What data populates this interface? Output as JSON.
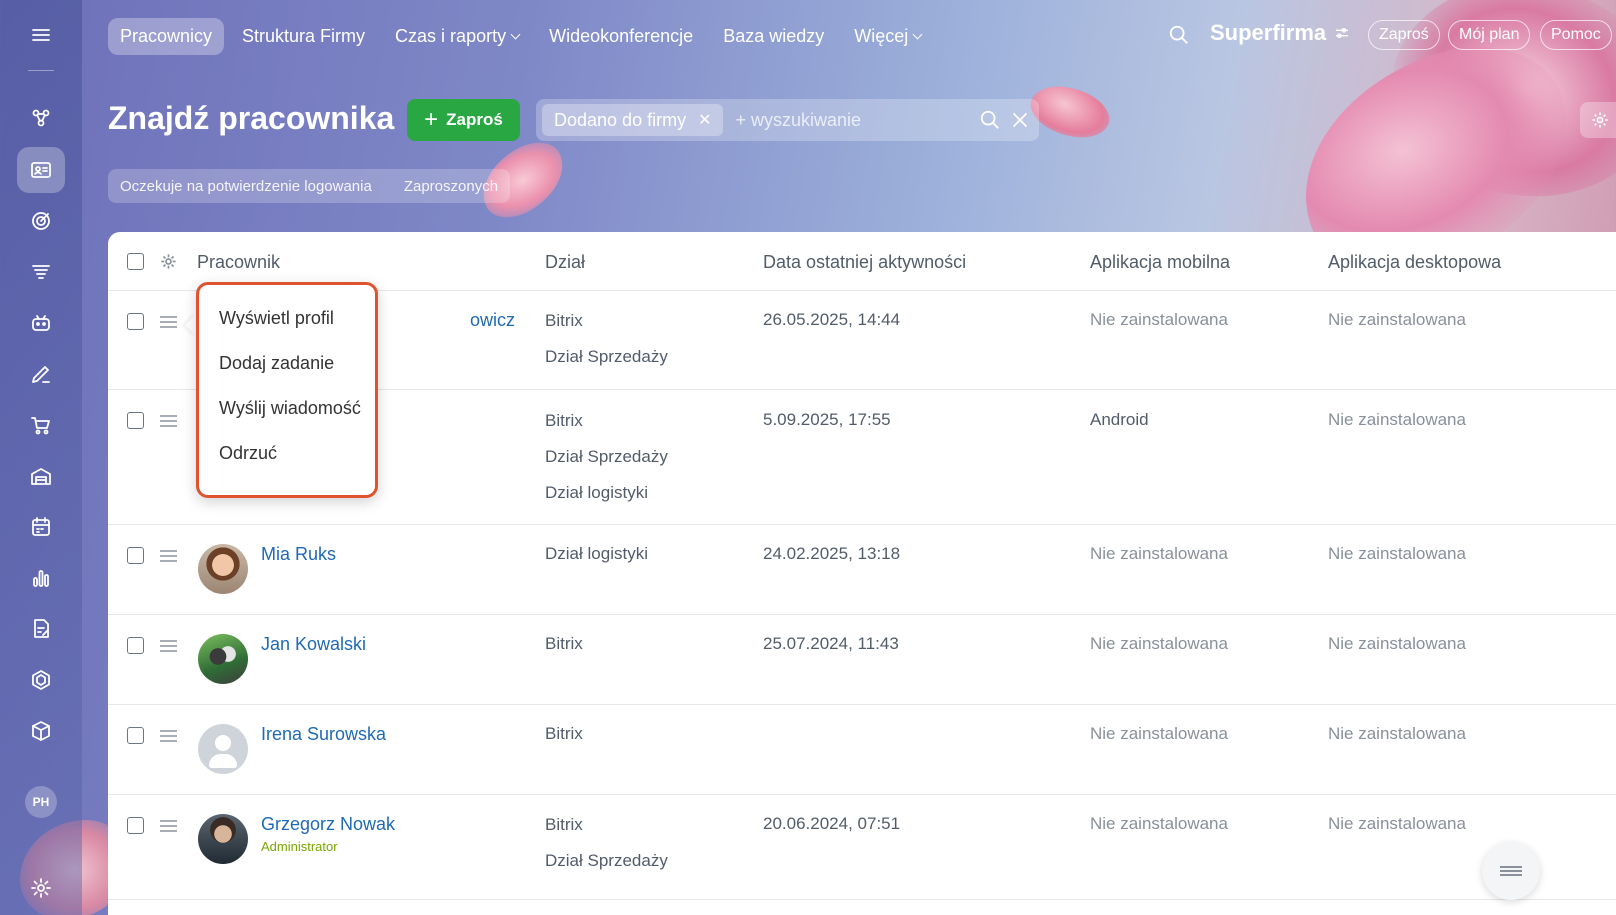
{
  "topnav": {
    "items": [
      {
        "label": "Pracownicy",
        "active": true,
        "dropdown": false
      },
      {
        "label": "Struktura Firmy",
        "active": false,
        "dropdown": false
      },
      {
        "label": "Czas i raporty",
        "active": false,
        "dropdown": true
      },
      {
        "label": "Wideokonferencje",
        "active": false,
        "dropdown": false
      },
      {
        "label": "Baza wiedzy",
        "active": false,
        "dropdown": false
      },
      {
        "label": "Więcej",
        "active": false,
        "dropdown": true
      }
    ],
    "brand": "Superfirma",
    "invite_pill": "Zaproś",
    "plan_pill": "Mój plan",
    "help_pill": "Pomoc"
  },
  "sidebar": {
    "icons": [
      "menu-icon",
      "chats-icon",
      "employees-icon",
      "goals-icon",
      "filter-icon",
      "bot-icon",
      "sign-icon",
      "cart-icon",
      "warehouse-icon",
      "calendar-icon",
      "analytics-icon",
      "forms-icon",
      "hexagon-icon",
      "box-icon",
      "settings-icon"
    ],
    "user_initials": "PH",
    "active": "employees-icon"
  },
  "header": {
    "title": "Znajdź pracownika",
    "invite_button": "Zaproś",
    "filter_chip": "Dodano do firmy",
    "search_placeholder": "+ wyszukiwanie",
    "subtabs": [
      "Oczekuje na potwierdzenie logowania",
      "Zaproszonych"
    ]
  },
  "table": {
    "columns": [
      "Pracownik",
      "Dział",
      "Data ostatniej aktywności",
      "Aplikacja mobilna",
      "Aplikacja desktopowa"
    ],
    "rows": [
      {
        "name_fragment": "owicz",
        "departments": [
          "Bitrix",
          "Dział Sprzedaży"
        ],
        "last_activity": "26.05.2025, 14:44",
        "mobile": "Nie zainstalowana",
        "desktop": "Nie zainstalowana"
      },
      {
        "name_fragment": "",
        "departments": [
          "Bitrix",
          "Dział Sprzedaży",
          "Dział logistyki"
        ],
        "last_activity": "5.09.2025, 17:55",
        "mobile": "Android",
        "desktop": "Nie zainstalowana"
      },
      {
        "name": "Mia Ruks",
        "departments": [
          "Dział logistyki"
        ],
        "last_activity": "24.02.2025, 13:18",
        "mobile": "Nie zainstalowana",
        "desktop": "Nie zainstalowana"
      },
      {
        "name": "Jan Kowalski",
        "departments": [
          "Bitrix"
        ],
        "last_activity": "25.07.2024, 11:43",
        "mobile": "Nie zainstalowana",
        "desktop": "Nie zainstalowana"
      },
      {
        "name": "Irena Surowska",
        "departments": [
          "Bitrix"
        ],
        "last_activity": "",
        "mobile": "Nie zainstalowana",
        "desktop": "Nie zainstalowana"
      },
      {
        "name": "Grzegorz Nowak",
        "role": "Administrator",
        "departments": [
          "Bitrix",
          "Dział Sprzedaży"
        ],
        "last_activity": "20.06.2024, 07:51",
        "mobile": "Nie zainstalowana",
        "desktop": "Nie zainstalowana"
      }
    ]
  },
  "context_menu": {
    "items": [
      "Wyświetl profil",
      "Dodaj zadanie",
      "Wyślij wiadomość",
      "Odrzuć"
    ]
  },
  "colors": {
    "accent_green": "#29a743",
    "link_blue": "#1f6ab5",
    "highlight_border": "#e0532f",
    "admin_green": "#7aa500"
  }
}
